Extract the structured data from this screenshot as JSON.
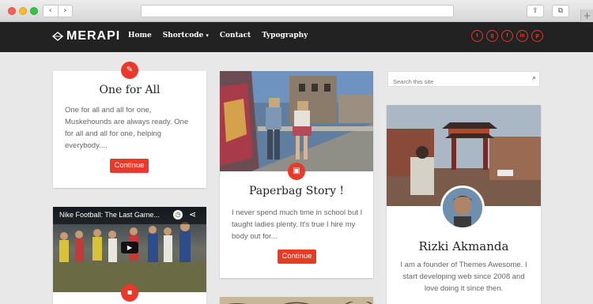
{
  "browser": {
    "back_glyph": "‹",
    "forward_glyph": "›",
    "share_glyph": "⇪",
    "tabs_glyph": "⧉",
    "newtab_glyph": "+"
  },
  "site": {
    "logo_text": "MERAPI",
    "menu": [
      "Home",
      "Shortcode",
      "Contact",
      "Typography"
    ],
    "shortcode_caret": "▾",
    "social": [
      "t",
      "g",
      "f",
      "in",
      "p"
    ]
  },
  "posts": [
    {
      "title": "One for All",
      "body": "One for all and all for one, Muskehounds are always ready. One for all and all for one, helping everybody....",
      "button": "Continue"
    },
    {
      "title": "Paperbag Story !",
      "body": "I never spend much time in school but I taught ladies plenty. It's true I hire my body out for...",
      "button": "Continue"
    }
  ],
  "video": {
    "title": "Nike Football: The Last Game..."
  },
  "sidebar": {
    "search_placeholder": "Search this site",
    "profile_name": "Rizki Akmanda",
    "profile_bio": "I am a founder of Themes Awesome. I start developing web since 2008 and love doing it since then."
  },
  "colors": {
    "accent": "#e8392b",
    "nav_bg": "#222222",
    "page_bg": "#e8e8e8"
  }
}
